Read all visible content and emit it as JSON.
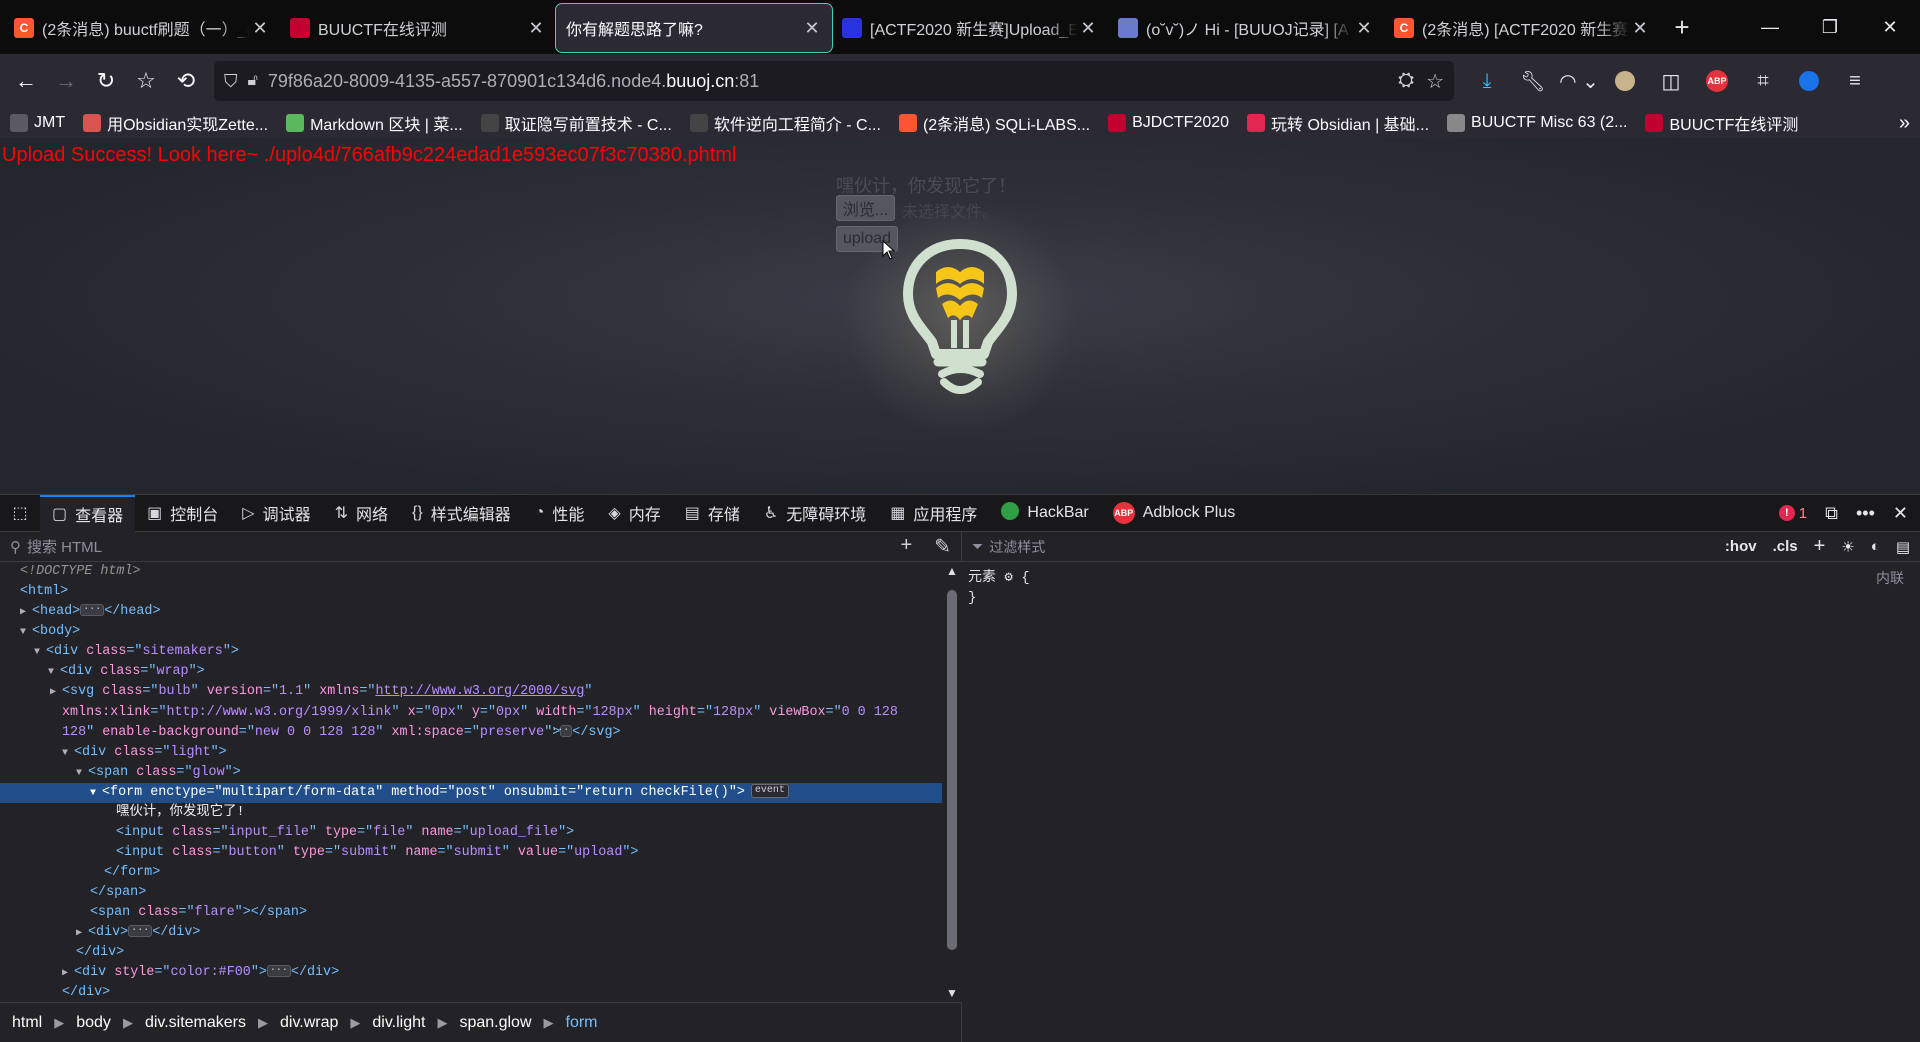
{
  "tabs": [
    {
      "label": "(2条消息) buuctf刷题（一）_(",
      "favicon": "C",
      "favcolor": "#fc5531",
      "active": false
    },
    {
      "label": "BUUCTF在线评测",
      "favicon": "",
      "favcolor": "#c3002f",
      "active": false
    },
    {
      "label": "你有解题思路了嘛?",
      "favicon": "",
      "favcolor": "",
      "active": true
    },
    {
      "label": "[ACTF2020 新生赛]Upload_E",
      "favicon": "",
      "favcolor": "#2932e1",
      "active": false
    },
    {
      "label": "(o˘v˘)ノ Hi - [BUUOJ记录] [A",
      "favicon": "",
      "favcolor": "#6a7cc9",
      "active": false
    },
    {
      "label": "(2条消息) [ACTF2020 新生赛]",
      "favicon": "C",
      "favcolor": "#fc5531",
      "active": false
    }
  ],
  "url": {
    "prefix": "79f86a20-8009-4135-a557-870901c134d6.node4.",
    "domain": "buuoj.cn",
    "port": ":81"
  },
  "bookmarks": [
    {
      "label": "JMT",
      "color": "#5a5a62"
    },
    {
      "label": "用Obsidian实现Zette...",
      "color": "#d9534f"
    },
    {
      "label": "Markdown 区块 | 菜...",
      "color": "#5cb85c"
    },
    {
      "label": "取证隐写前置技术 - C...",
      "color": "#444"
    },
    {
      "label": "软件逆向工程简介 - C...",
      "color": "#444"
    },
    {
      "label": "(2条消息) SQLi-LABS...",
      "color": "#fc5531"
    },
    {
      "label": "BJDCTF2020",
      "color": "#c3002f"
    },
    {
      "label": "玩转 Obsidian | 基础...",
      "color": "#e22850"
    },
    {
      "label": "BUUCTF Misc 63 (2...",
      "color": "#888"
    },
    {
      "label": "BUUCTF在线评测",
      "color": "#c3002f"
    }
  ],
  "page": {
    "success": "Upload Success! Look here~ ./uplo4d/766afb9c224edad1e593ec07f3c70380.phtml",
    "form_text": "嘿伙计，你发现它了！",
    "browse": "浏览...",
    "nofile": "未选择文件。",
    "upload": "upload"
  },
  "devtools": {
    "tabs": [
      {
        "label": "查看器",
        "icon": "▢",
        "active": true
      },
      {
        "label": "控制台",
        "icon": "▣"
      },
      {
        "label": "调试器",
        "icon": "▷"
      },
      {
        "label": "网络",
        "icon": "⇅"
      },
      {
        "label": "样式编辑器",
        "icon": "{}"
      },
      {
        "label": "性能",
        "icon": "◔"
      },
      {
        "label": "内存",
        "icon": "◈"
      },
      {
        "label": "存储",
        "icon": "▤"
      },
      {
        "label": "无障碍环境",
        "icon": "♿"
      },
      {
        "label": "应用程序",
        "icon": "▦"
      },
      {
        "label": "HackBar",
        "icon": ""
      },
      {
        "label": "Adblock Plus",
        "icon": ""
      }
    ],
    "error_count": "1",
    "search_placeholder": "搜索 HTML",
    "filter_placeholder": "过滤样式",
    "hov": ":hov",
    "cls": ".cls",
    "element_rule": "元素",
    "inline": "内联",
    "breadcrumbs": [
      "html",
      "body",
      "div.sitemakers",
      "div.wrap",
      "div.light",
      "span.glow",
      "form"
    ]
  },
  "markup": {
    "doctype": "<!DOCTYPE html>",
    "form_text": "嘿伙计，你发现它了!",
    "svg_attrs": "class=\"bulb\" version=\"1.1\" xmlns=\"http://www.w3.org/2000/svg\" xmlns:xlink=\"http://www.w3.org/1999/xlink\" x=\"0px\" y=\"0px\" width=\"128px\" height=\"128px\" viewBox=\"0 0 128 128\" enable-background=\"new 0 0 128 128\" xml:space=\"preserve\"",
    "event": "event"
  }
}
